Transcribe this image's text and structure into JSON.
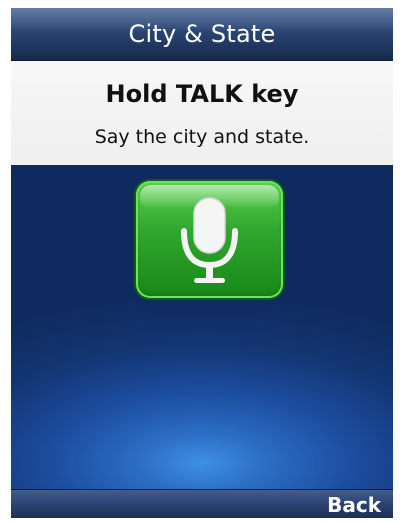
{
  "title_bar": {
    "title": "City & State"
  },
  "prompt": {
    "heading": "Hold TALK key",
    "subtext": "Say the city and state."
  },
  "voice_control": {
    "icon": "microphone-icon",
    "accent_color": "#2fad2e"
  },
  "soft_keys": {
    "right_label": "Back"
  }
}
